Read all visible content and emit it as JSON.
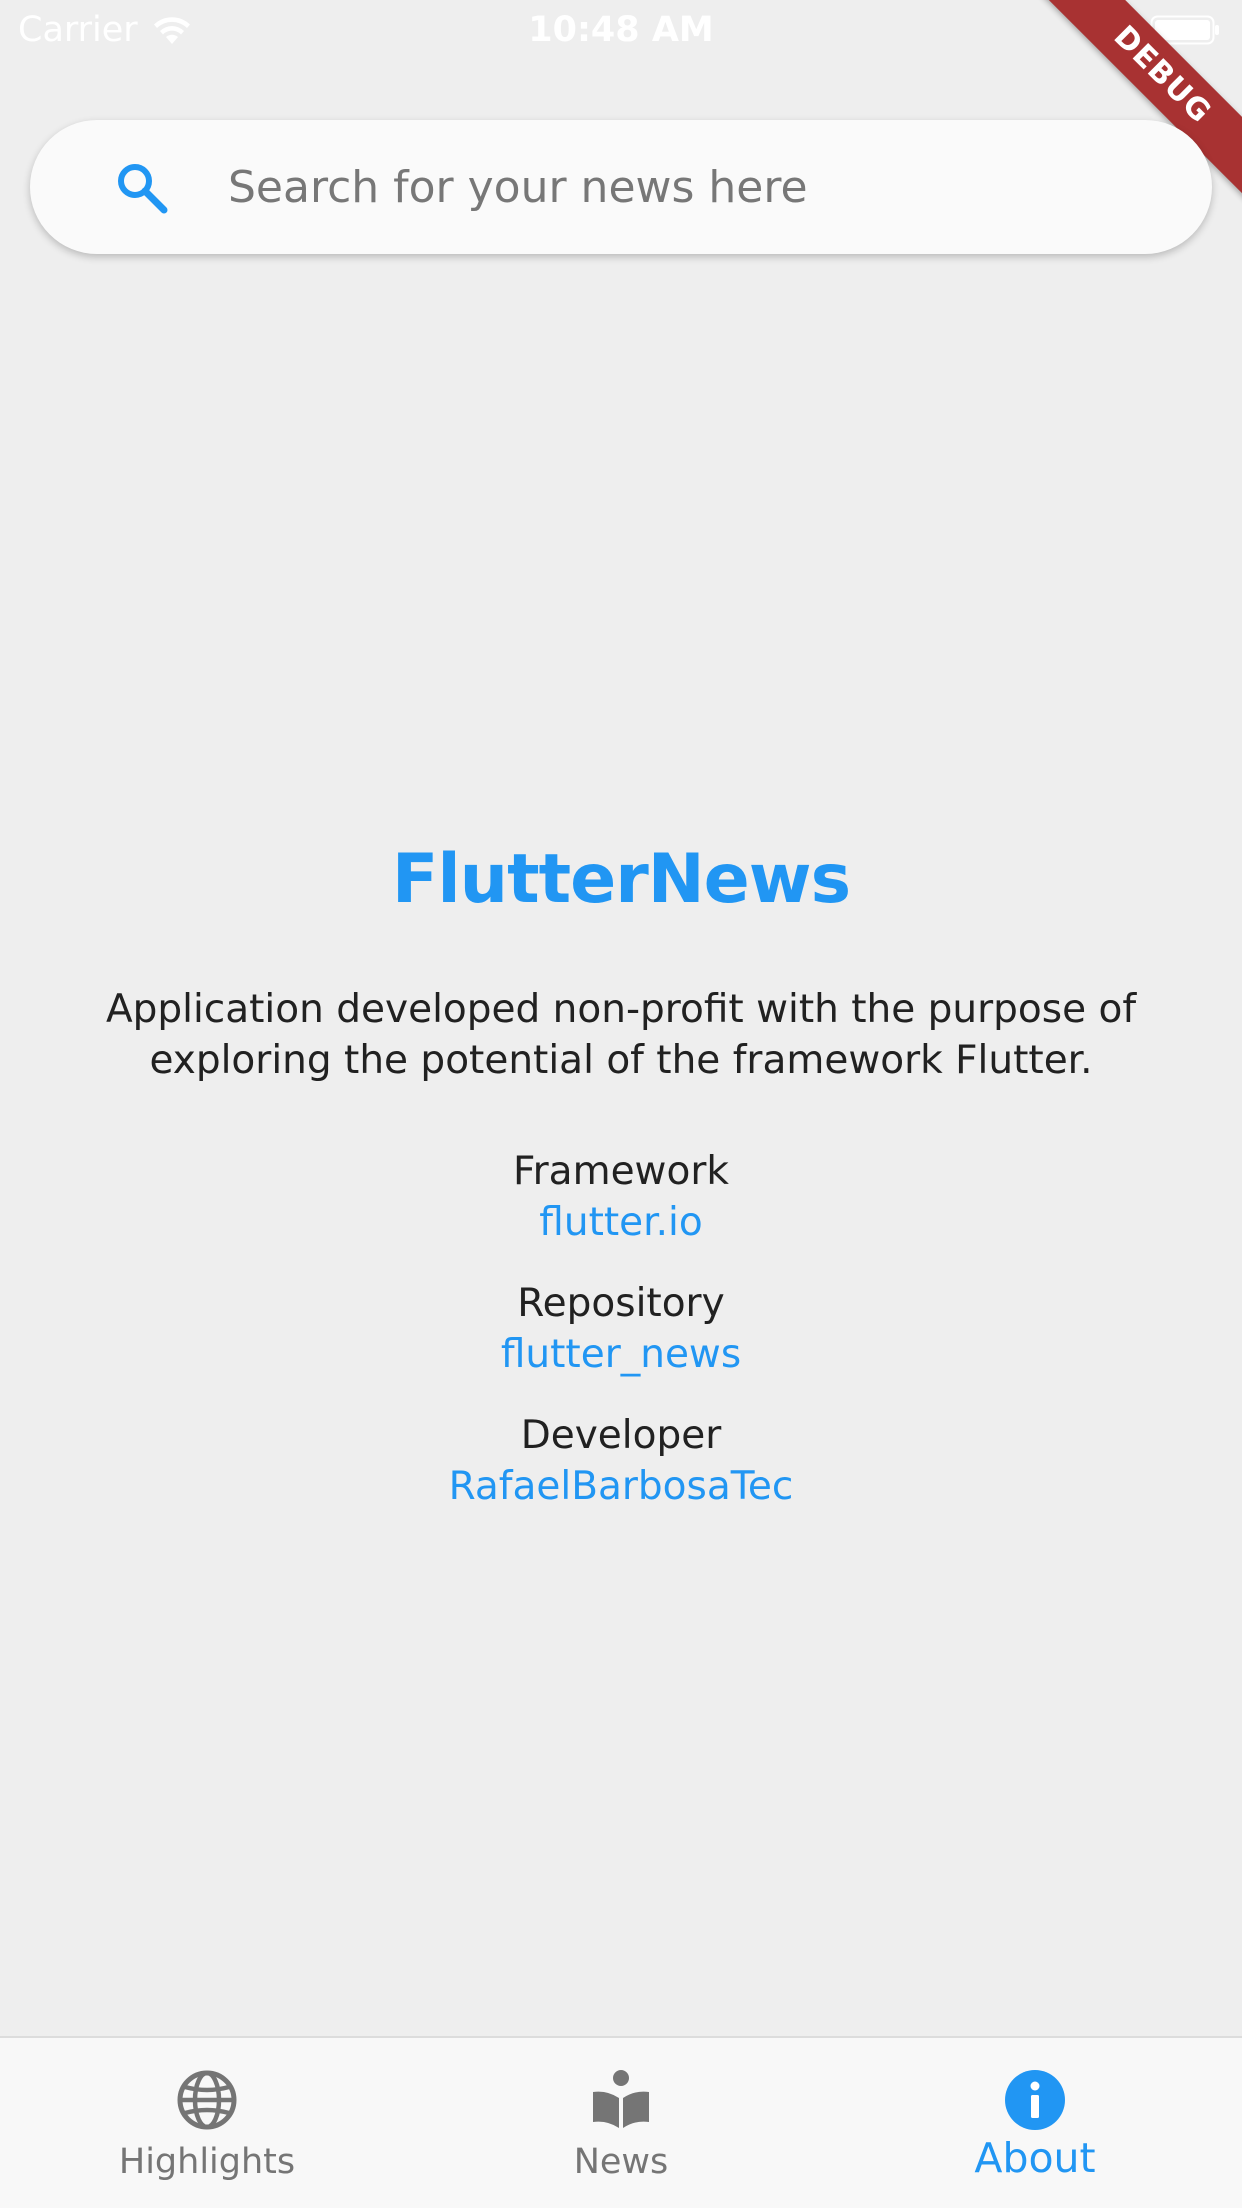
{
  "status_bar": {
    "carrier": "Carrier",
    "time": "10:48 AM"
  },
  "debug_banner": "DEBUG",
  "search": {
    "placeholder": "Search for your news here",
    "value": "",
    "icon": "search-icon"
  },
  "about": {
    "title": "FlutterNews",
    "description": "Application developed non-profit with the purpose of exploring the potential of the framework Flutter.",
    "items": [
      {
        "label": "Framework",
        "link": "flutter.io"
      },
      {
        "label": "Repository",
        "link": "flutter_news"
      },
      {
        "label": "Developer",
        "link": "RafaelBarbosaTec"
      }
    ]
  },
  "bottom_nav": {
    "items": [
      {
        "label": "Highlights",
        "icon": "globe-icon",
        "active": false
      },
      {
        "label": "News",
        "icon": "book-reader-icon",
        "active": false
      },
      {
        "label": "About",
        "icon": "info-icon",
        "active": true
      }
    ]
  },
  "colors": {
    "accent": "#2196f3",
    "background": "#eeeeee",
    "inactive": "#757575",
    "debug_ribbon": "#a83232"
  }
}
